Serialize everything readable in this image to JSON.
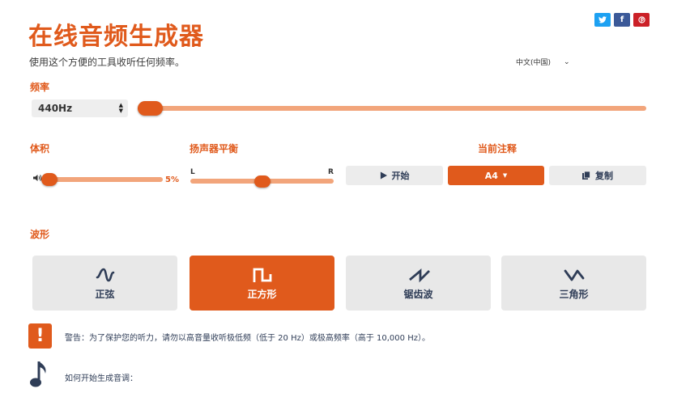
{
  "header": {
    "title": "在线音频生成器",
    "subtitle": "使用这个方便的工具收听任何频率。"
  },
  "social": [
    {
      "name": "twitter",
      "glyph": "✔",
      "color": "#1da1f2"
    },
    {
      "name": "facebook",
      "glyph": "f",
      "color": "#3b5998"
    },
    {
      "name": "pinterest",
      "glyph": "℗",
      "color": "#cb2027"
    }
  ],
  "language": {
    "selected": "中文(中国)",
    "chevron": "⌄"
  },
  "frequency": {
    "label": "频率",
    "value": "440Hz",
    "slider_fraction": 0.025
  },
  "volume": {
    "label": "体积",
    "percent_text": "5%",
    "level": 0.05
  },
  "balance": {
    "label": "扬声器平衡",
    "left": "L",
    "right": "R",
    "position": 0.5
  },
  "note": {
    "label": "当前注释",
    "start_label": "开始",
    "note_value": "A4",
    "copy_label": "复制"
  },
  "waveform": {
    "label": "波形",
    "options": [
      {
        "label": "正弦",
        "icon": "sine-wave-icon",
        "selected": false
      },
      {
        "label": "正方形",
        "icon": "square-wave-icon",
        "selected": true
      },
      {
        "label": "锯齿波",
        "icon": "sawtooth-wave-icon",
        "selected": false
      },
      {
        "label": "三角形",
        "icon": "triangle-wave-icon",
        "selected": false
      }
    ]
  },
  "warning": {
    "icon": "!",
    "text": "警告：为了保护您的听力，请勿以高音量收听极低频（低于 20 Hz）或极高频率（高于 10,000 Hz）。"
  },
  "howto": {
    "text": "如何开始生成音调："
  },
  "colors": {
    "accent": "#e05a1c",
    "accent_light": "#f2a57b",
    "button_grey": "#e8e8e8",
    "text_dark": "#2f3d57"
  }
}
